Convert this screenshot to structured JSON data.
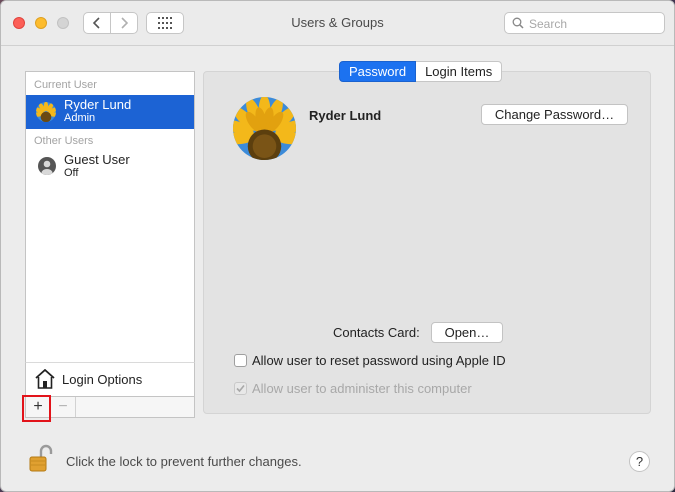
{
  "window": {
    "title": "Users & Groups"
  },
  "search": {
    "placeholder": "Search"
  },
  "sidebar": {
    "current_user_label": "Current User",
    "other_users_label": "Other Users",
    "users": [
      {
        "name": "Ryder Lund",
        "role": "Admin",
        "selected": true,
        "icon": "sunflower-avatar-icon"
      },
      {
        "name": "Guest User",
        "role": "Off",
        "selected": false,
        "icon": "guest-user-icon"
      }
    ],
    "login_options_label": "Login Options",
    "add_label": "+",
    "remove_label": "−"
  },
  "tabs": [
    {
      "label": "Password",
      "active": true
    },
    {
      "label": "Login Items",
      "active": false
    }
  ],
  "main": {
    "user_name": "Ryder Lund",
    "change_password_label": "Change Password…",
    "contacts_card_label": "Contacts Card:",
    "open_label": "Open…",
    "allow_reset_label": "Allow user to reset password using Apple ID",
    "allow_reset_checked": false,
    "allow_admin_label": "Allow user to administer this computer",
    "allow_admin_checked": true,
    "allow_admin_enabled": false
  },
  "footer": {
    "lock_text": "Click the lock to prevent further changes.",
    "help_label": "?"
  },
  "colors": {
    "accent": "#1c63d4",
    "tab_active": "#1c72f0",
    "highlight_box": "#e2131a"
  }
}
